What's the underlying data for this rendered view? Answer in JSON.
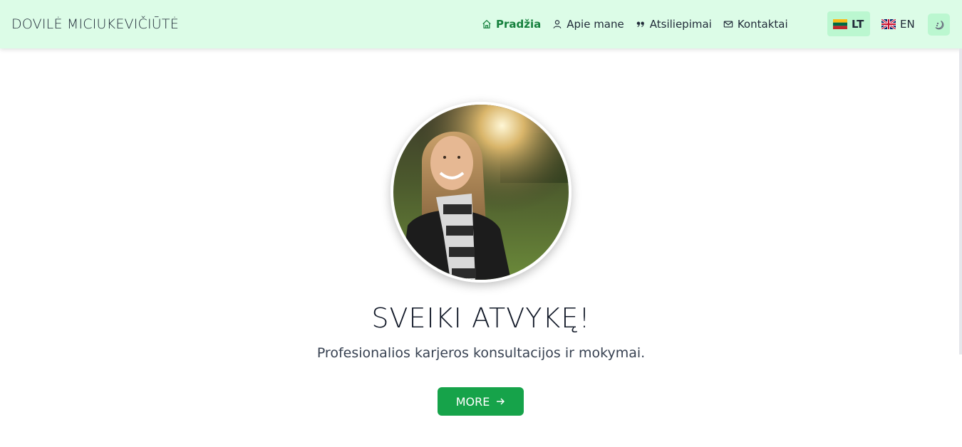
{
  "brand": "DOVILĖ MICIUKEVIČIŪTĖ",
  "nav": {
    "items": [
      {
        "label": "Pradžia",
        "icon": "home-icon",
        "active": true
      },
      {
        "label": "Apie mane",
        "icon": "user-icon",
        "active": false
      },
      {
        "label": "Atsiliepimai",
        "icon": "quote-icon",
        "active": false
      },
      {
        "label": "Kontaktai",
        "icon": "mail-icon",
        "active": false
      }
    ]
  },
  "languages": [
    {
      "code": "LT",
      "flag": "lithuania-flag-icon",
      "active": true
    },
    {
      "code": "EN",
      "flag": "uk-flag-icon",
      "active": false
    }
  ],
  "theme_toggle": {
    "icon": "moon-icon"
  },
  "hero": {
    "title": "SVEIKI ATVYKĘ!",
    "subtitle": "Profesionalios karjeros konsultacijos ir mokymai.",
    "button_label": "MORE",
    "button_icon": "arrow-right-icon"
  },
  "colors": {
    "navbar_bg": "#dcfce7",
    "accent": "#16a34a",
    "active_link": "#15803d",
    "lang_active_bg": "#bbf7d0"
  }
}
